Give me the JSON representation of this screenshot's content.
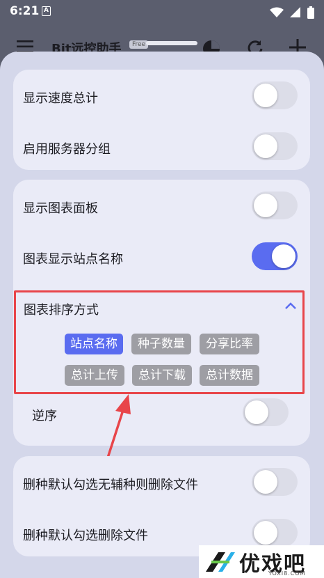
{
  "status_bar": {
    "time": "6:21",
    "notification_letter": "A"
  },
  "app_bar": {
    "title": "Bit远控助手",
    "badge": "Free"
  },
  "settings": {
    "card1": [
      {
        "label": "显示速度总计",
        "enabled": false
      },
      {
        "label": "启用服务器分组",
        "enabled": false
      }
    ],
    "card2": [
      {
        "label": "显示图表面板",
        "enabled": false
      },
      {
        "label": "图表显示站点名称",
        "enabled": true
      }
    ],
    "sort": {
      "title": "图表排序方式",
      "options": [
        "站点名称",
        "种子数量",
        "分享比率",
        "总计上传",
        "总计下载",
        "总计数据"
      ],
      "selected": "站点名称",
      "reverse_label": "逆序",
      "reverse_enabled": false
    },
    "card3": [
      {
        "label": "删种默认勾选无辅种则删除文件",
        "enabled": false
      },
      {
        "label": "删种默认勾选删除文件",
        "enabled": false
      }
    ]
  },
  "watermark": {
    "text": "优戏吧",
    "sub": "YOXI8.COM"
  },
  "colors": {
    "accent": "#5a6cf0",
    "highlight": "#e8454a",
    "chip_gray": "#9e9ea4",
    "card_bg": "#eaebf7",
    "sheet_bg": "#d4d7ea"
  }
}
